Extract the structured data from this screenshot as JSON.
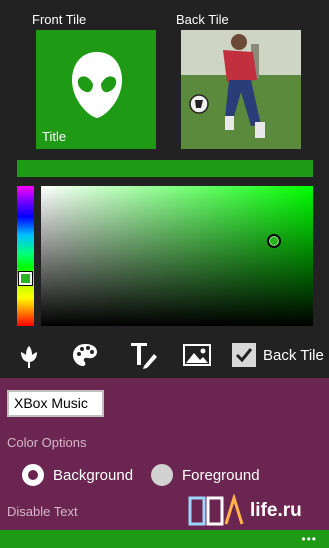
{
  "tiles": {
    "front_label": "Front Tile",
    "back_label": "Back Tile",
    "front_title": "Title",
    "front_color": "#1e9a14"
  },
  "picker": {
    "selected_color": "#1e9a14",
    "hue_marker_color": "#27b420"
  },
  "toolbar": {
    "icons": [
      "flower-icon",
      "palette-icon",
      "text-edit-icon",
      "image-icon"
    ],
    "back_tile_checkbox_label": "Back Tile",
    "back_tile_checked": true
  },
  "options": {
    "text_input_value": "XBox Music",
    "color_options_label": "Color Options",
    "background_label": "Background",
    "foreground_label": "Foreground",
    "selected": "Background",
    "disable_text_label": "Disable Text"
  },
  "watermark": {
    "text": "life.ru",
    "logo_text": "PDA"
  },
  "app_bar": {
    "more": "•••"
  },
  "colors": {
    "accent": "#1e9a14",
    "panel": "#6a2550",
    "background": "#222222"
  }
}
